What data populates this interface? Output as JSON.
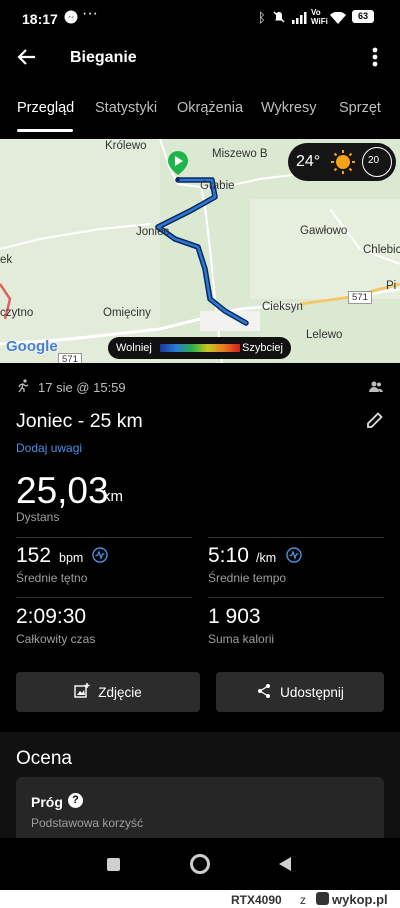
{
  "status": {
    "time": "18:17",
    "battery": "63",
    "wifi": "Vo WiFi"
  },
  "appbar": {
    "title": "Bieganie"
  },
  "tabs": [
    {
      "label": "Przegląd"
    },
    {
      "label": "Statystyki"
    },
    {
      "label": "Okrążenia"
    },
    {
      "label": "Wykresy"
    },
    {
      "label": "Sprzęt"
    }
  ],
  "map": {
    "towns": [
      "Królewo",
      "Miszewo B",
      "Grabie",
      "Joniec",
      "Gawłowo",
      "Chlebic",
      "Cieksyn",
      "Lelewo",
      "Omięciny",
      "czytno",
      "ek",
      "Pi"
    ],
    "road_labels": [
      "571",
      "571"
    ],
    "logo": "Google",
    "weather": {
      "temp": "24°",
      "wind": "20"
    },
    "speed_legend": {
      "slow": "Wolniej",
      "fast": "Szybciej"
    }
  },
  "activity": {
    "date": "17 sie @ 15:59",
    "title": "Joniec - 25 km",
    "add_notes": "Dodaj uwagi",
    "distance_value": "25,03",
    "distance_unit": "km",
    "distance_label": "Dystans"
  },
  "stats": [
    {
      "value": "152",
      "unit": "bpm",
      "label": "Średnie tętno"
    },
    {
      "value": "5:10",
      "unit": "/km",
      "label": "Średnie tempo"
    },
    {
      "value": "2:09:30",
      "unit": "",
      "label": "Całkowity czas"
    },
    {
      "value": "1 903",
      "unit": "",
      "label": "Suma kalorii"
    }
  ],
  "buttons": {
    "photo": "Zdjęcie",
    "share": "Udostępnij"
  },
  "evaluation": {
    "heading": "Ocena",
    "card_title": "Próg",
    "card_subtitle": "Podstawowa korzyść"
  },
  "footer": {
    "user": "RTX4090",
    "via": "z",
    "site": "wykop.pl"
  }
}
